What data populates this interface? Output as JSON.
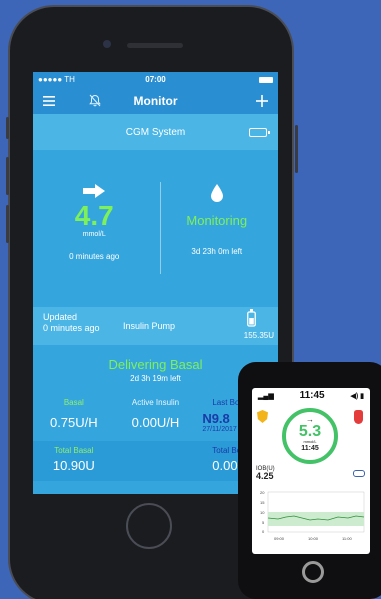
{
  "phone": {
    "status_bar": {
      "carrier": "●●●●● TH",
      "time": "07:00"
    },
    "nav": {
      "title": "Monitor",
      "menu_icon": "hamburger-icon",
      "bell_icon": "bell-off-icon",
      "add_icon": "plus-icon"
    },
    "cgm": {
      "section_title": "CGM System",
      "glucose_value": "4.7",
      "unit": "mmol/L",
      "updated": "0 minutes ago",
      "status": "Monitoring",
      "time_left": "3d 23h 0m left"
    },
    "pump": {
      "updated_label": "Updated",
      "updated_value": "0 minutes ago",
      "name": "Insulin Pump",
      "reservoir": "155.35U"
    },
    "basal": {
      "status": "Delivering Basal",
      "remaining": "2d 3h 19m left",
      "basal_label": "Basal",
      "basal_value": "0.75U/H",
      "active_label": "Active Insulin",
      "active_value": "0.00U/H",
      "last_bolus_label": "Last Bo",
      "last_bolus_value": "N9.8",
      "last_bolus_date": "27/11/2017",
      "total_basal_label": "Total Basal",
      "total_basal_value": "10.90U",
      "total_bolus_label": "Total Bo",
      "total_bolus_value": "0.00"
    },
    "colors": {
      "screen": "#35a6dd",
      "accent_green": "#7ef05a",
      "nav": "#2a8fd2"
    }
  },
  "device": {
    "time": "11:45",
    "glucose_value": "5.3",
    "unit": "mmol/L",
    "reading_time": "11:45",
    "iob_label": "IOB(U)",
    "iob_value": "4.25",
    "chart_ticks_y": [
      "20",
      "15",
      "10",
      "5",
      "0"
    ],
    "chart_ticks_x": [
      "09:00",
      "10:00",
      "11:00"
    ]
  }
}
